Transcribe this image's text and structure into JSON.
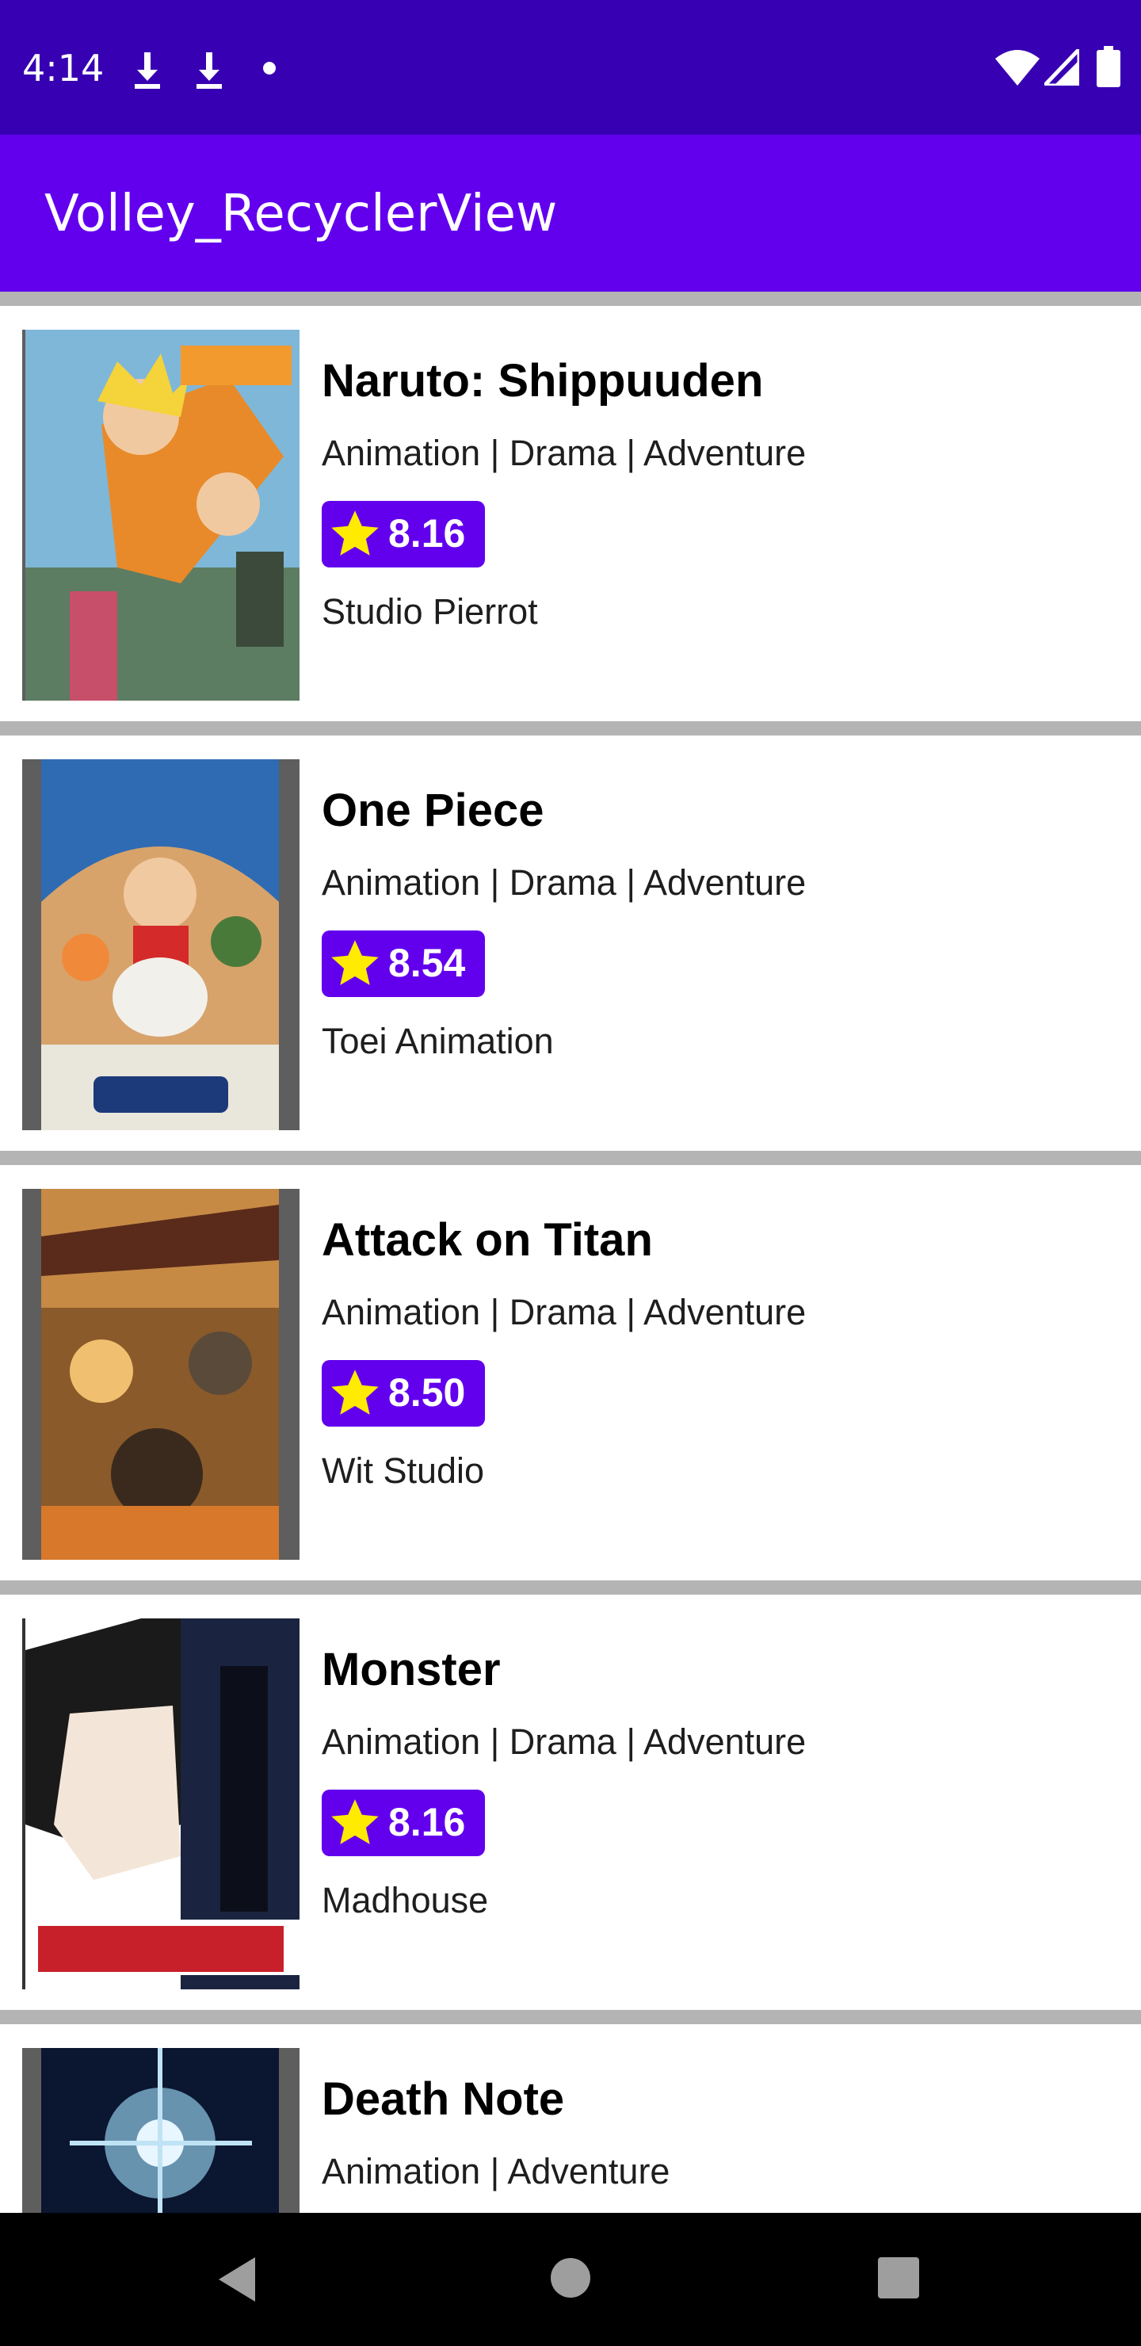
{
  "status_bar": {
    "time": "4:14",
    "icons": [
      "download-icon",
      "download-icon",
      "dot-icon",
      "wifi-icon",
      "signal-icon",
      "battery-icon"
    ]
  },
  "app_bar": {
    "title": "Volley_RecyclerView",
    "color": "#6200ee"
  },
  "items": [
    {
      "title": "Naruto: Shippuuden",
      "genre": "Animation | Drama | Adventure",
      "rating": "8.16",
      "studio": "Studio Pierrot"
    },
    {
      "title": "One Piece",
      "genre": "Animation | Drama | Adventure",
      "rating": "8.54",
      "studio": "Toei Animation"
    },
    {
      "title": "Attack on Titan",
      "genre": "Animation | Drama | Adventure",
      "rating": "8.50",
      "studio": "Wit Studio"
    },
    {
      "title": "Monster",
      "genre": "Animation | Drama | Adventure",
      "rating": "8.16",
      "studio": "Madhouse"
    },
    {
      "title": "Death Note",
      "genre": "Animation | Adventure",
      "rating": "",
      "studio": ""
    }
  ],
  "nav_bar": {
    "buttons": [
      "back-icon",
      "home-icon",
      "recents-icon"
    ]
  },
  "colors": {
    "status_bar": "#3700b3",
    "accent": "#6200ee",
    "star": "#ffeb00",
    "divider": "#b4b4b4"
  }
}
